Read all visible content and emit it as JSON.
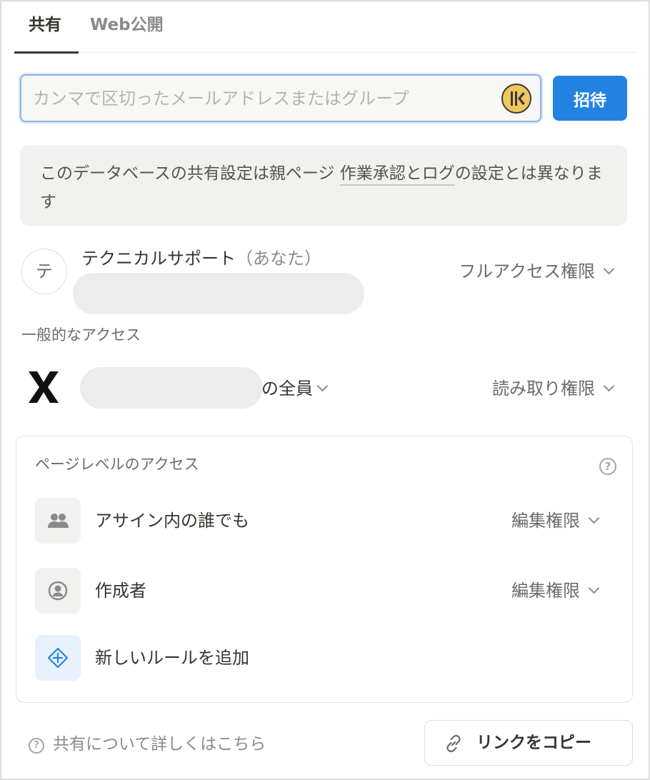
{
  "tabs": [
    {
      "label": "共有",
      "active": true
    },
    {
      "label": "Web公開",
      "active": false
    }
  ],
  "invite": {
    "placeholder": "カンマで区切ったメールアドレスまたはグループ",
    "button_label": "招待"
  },
  "notice": {
    "prefix": "このデータベースの共有設定は親ページ ",
    "link_text": "作業承認とログ",
    "suffix": "の設定とは異なります"
  },
  "member": {
    "avatar_initial": "テ",
    "name": "テクニカルサポート",
    "you_label": "（あなた）",
    "permission": "フルアクセス権限"
  },
  "general_access": {
    "label": "一般的なアクセス",
    "workspace_suffix": "の全員",
    "permission": "読み取り権限"
  },
  "page_level": {
    "title": "ページレベルのアクセス",
    "help_icon": "?",
    "rules": [
      {
        "icon": "people-icon",
        "label": "アサイン内の誰でも",
        "permission": "編集権限"
      },
      {
        "icon": "user-circle-icon",
        "label": "作成者",
        "permission": "編集権限"
      }
    ],
    "add_rule_label": "新しいルールを追加"
  },
  "footer": {
    "help_icon": "?",
    "help_text": "共有について詳しくはこちら",
    "copy_link_label": "リンクをコピー"
  },
  "colors": {
    "accent": "#2383e2",
    "text": "#37352f",
    "muted": "#8a8a8a",
    "notice_bg": "#f1f1ef"
  }
}
